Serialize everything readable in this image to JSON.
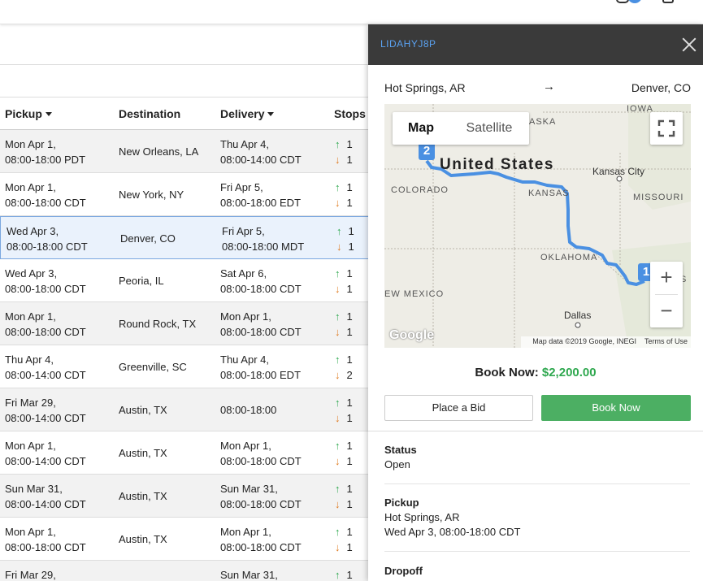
{
  "table": {
    "headers": {
      "pickup": "Pickup",
      "destination": "Destination",
      "delivery": "Delivery",
      "stops": "Stops"
    },
    "rows": [
      {
        "pickup_day": "Mon Apr 1,",
        "pickup_time": "08:00-18:00 PDT",
        "destination": "New Orleans, LA",
        "delivery_day": "Thu Apr 4,",
        "delivery_time": "08:00-14:00 CDT",
        "stops_up": "1",
        "stops_down": "1"
      },
      {
        "pickup_day": "Mon Apr 1,",
        "pickup_time": "08:00-18:00 CDT",
        "destination": "New York, NY",
        "delivery_day": "Fri Apr 5,",
        "delivery_time": "08:00-18:00 EDT",
        "stops_up": "1",
        "stops_down": "1"
      },
      {
        "pickup_day": "Wed Apr 3,",
        "pickup_time": "08:00-18:00 CDT",
        "destination": "Denver, CO",
        "delivery_day": "Fri Apr 5,",
        "delivery_time": "08:00-18:00 MDT",
        "stops_up": "1",
        "stops_down": "1"
      },
      {
        "pickup_day": "Wed Apr 3,",
        "pickup_time": "08:00-18:00 CDT",
        "destination": "Peoria, IL",
        "delivery_day": "Sat Apr 6,",
        "delivery_time": "08:00-18:00 CDT",
        "stops_up": "1",
        "stops_down": "1"
      },
      {
        "pickup_day": "Mon Apr 1,",
        "pickup_time": "08:00-18:00 CDT",
        "destination": "Round Rock, TX",
        "delivery_day": "Mon Apr 1,",
        "delivery_time": "08:00-18:00 CDT",
        "stops_up": "1",
        "stops_down": "1"
      },
      {
        "pickup_day": "Thu Apr 4,",
        "pickup_time": "08:00-14:00 CDT",
        "destination": "Greenville, SC",
        "delivery_day": "Thu Apr 4,",
        "delivery_time": "08:00-18:00 EDT",
        "stops_up": "1",
        "stops_down": "2"
      },
      {
        "pickup_day": "Fri Mar 29,",
        "pickup_time": "08:00-14:00 CDT",
        "destination": "Austin, TX",
        "delivery_day": "",
        "delivery_time": "08:00-18:00",
        "stops_up": "1",
        "stops_down": "1"
      },
      {
        "pickup_day": "Mon Apr 1,",
        "pickup_time": "08:00-14:00 CDT",
        "destination": "Austin, TX",
        "delivery_day": "Mon Apr 1,",
        "delivery_time": "08:00-18:00 CDT",
        "stops_up": "1",
        "stops_down": "1"
      },
      {
        "pickup_day": "Sun Mar 31,",
        "pickup_time": "08:00-14:00 CDT",
        "destination": "Austin, TX",
        "delivery_day": "Sun Mar 31,",
        "delivery_time": "08:00-18:00 CDT",
        "stops_up": "1",
        "stops_down": "1"
      },
      {
        "pickup_day": "Mon Apr 1,",
        "pickup_time": "08:00-18:00 CDT",
        "destination": "Austin, TX",
        "delivery_day": "Mon Apr 1,",
        "delivery_time": "08:00-18:00 CDT",
        "stops_up": "1",
        "stops_down": "1"
      },
      {
        "pickup_day": "Fri Mar 29,",
        "pickup_time": "",
        "destination": "",
        "delivery_day": "Sun Mar 31,",
        "delivery_time": "",
        "stops_up": "1",
        "stops_down": ""
      }
    ]
  },
  "panel": {
    "load_id": "LIDAHYJ8P",
    "origin": "Hot Springs, AR",
    "destination": "Denver, CO",
    "map": {
      "map_label": "Map",
      "satellite_label": "Satellite",
      "labels": {
        "united_states": "United States",
        "iowa": "IOWA",
        "aska": "ASKA",
        "kansas_city": "Kansas City",
        "colorado": "COLORADO",
        "kansas": "KANSAS",
        "missouri": "MISSOURI",
        "oklahoma": "OKLAHOMA",
        "new_mexico": "EW MEXICO",
        "dallas": "Dallas",
        "s": "S"
      },
      "marker_origin": "1",
      "marker_dest": "2",
      "logo": "Google",
      "attribution": "Map data ©2019 Google, INEGI",
      "terms": "Terms of Use"
    },
    "book_now_label": "Book Now:",
    "price": "$2,200.00",
    "place_bid": "Place a Bid",
    "book_now_button": "Book Now",
    "status_label": "Status",
    "status_value": "Open",
    "pickup_label": "Pickup",
    "pickup_location": "Hot Springs, AR",
    "pickup_time": "Wed Apr 3, 08:00-18:00 CDT",
    "dropoff_label": "Dropoff"
  },
  "colors": {
    "accent_blue": "#4a90e2",
    "success_green": "#4caf63",
    "price_green": "#2fa84f",
    "dropoff_arrow": "#e07b20",
    "header_dark": "#3a3a3a"
  },
  "icons": [
    "chat-icon",
    "cart-icon",
    "close-icon",
    "arrow-right-icon",
    "fullscreen-icon",
    "pickup-arrow-icon",
    "dropoff-arrow-icon"
  ]
}
